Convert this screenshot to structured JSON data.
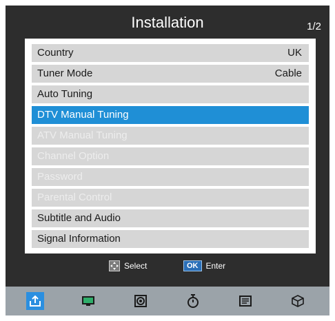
{
  "header": {
    "title": "Installation",
    "page": "1/2"
  },
  "menu": [
    {
      "label": "Country",
      "value": "UK",
      "state": "normal"
    },
    {
      "label": "Tuner Mode",
      "value": "Cable",
      "state": "normal"
    },
    {
      "label": "Auto Tuning",
      "value": "",
      "state": "normal"
    },
    {
      "label": "DTV Manual Tuning",
      "value": "",
      "state": "selected"
    },
    {
      "label": "ATV Manual Tuning",
      "value": "",
      "state": "disabled"
    },
    {
      "label": "Channel Option",
      "value": "",
      "state": "disabled"
    },
    {
      "label": "Password",
      "value": "",
      "state": "disabled"
    },
    {
      "label": "Parental Control",
      "value": "",
      "state": "disabled"
    },
    {
      "label": "Subtitle and Audio",
      "value": "",
      "state": "normal"
    },
    {
      "label": "Signal Information",
      "value": "",
      "state": "normal"
    }
  ],
  "hints": {
    "select_label": "Select",
    "ok_key": "OK",
    "enter_label": "Enter"
  },
  "tabs": [
    {
      "icon": "installation-icon",
      "active": true
    },
    {
      "icon": "picture-icon",
      "active": false
    },
    {
      "icon": "sound-icon",
      "active": false
    },
    {
      "icon": "timer-icon",
      "active": false
    },
    {
      "icon": "options-icon",
      "active": false
    },
    {
      "icon": "apps-cube-icon",
      "active": false
    }
  ],
  "colors": {
    "background": "#2d2d2d",
    "selected_row": "#1f8fd6",
    "row": "#d6d6d6",
    "active_tab": "#2b8fe0"
  }
}
